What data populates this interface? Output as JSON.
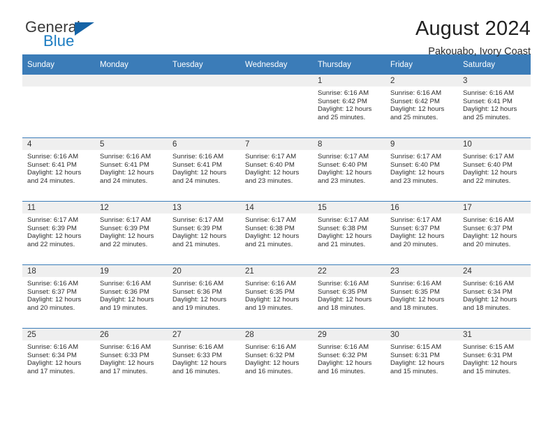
{
  "brand": {
    "name_top": "General",
    "name_bottom": "Blue",
    "triangle_color": "#1463a6",
    "blue_color": "#1b7cc2"
  },
  "header": {
    "title": "August 2024",
    "subtitle": "Pakouabo, Ivory Coast"
  },
  "theme": {
    "header_bg": "#3b7cb8",
    "daynum_bg": "#efefef",
    "grid_line": "#3b7cb8"
  },
  "labels": {
    "sunrise_prefix": "Sunrise: ",
    "sunset_prefix": "Sunset: ",
    "daylight_prefix": "Daylight: "
  },
  "weekday_headers": [
    "Sunday",
    "Monday",
    "Tuesday",
    "Wednesday",
    "Thursday",
    "Friday",
    "Saturday"
  ],
  "weeks": [
    [
      {
        "day": "",
        "empty": true
      },
      {
        "day": "",
        "empty": true
      },
      {
        "day": "",
        "empty": true
      },
      {
        "day": "",
        "empty": true
      },
      {
        "day": "1",
        "sunrise": "Sunrise: 6:16 AM",
        "sunset": "Sunset: 6:42 PM",
        "daylight": "Daylight: 12 hours and 25 minutes."
      },
      {
        "day": "2",
        "sunrise": "Sunrise: 6:16 AM",
        "sunset": "Sunset: 6:42 PM",
        "daylight": "Daylight: 12 hours and 25 minutes."
      },
      {
        "day": "3",
        "sunrise": "Sunrise: 6:16 AM",
        "sunset": "Sunset: 6:41 PM",
        "daylight": "Daylight: 12 hours and 25 minutes."
      }
    ],
    [
      {
        "day": "4",
        "sunrise": "Sunrise: 6:16 AM",
        "sunset": "Sunset: 6:41 PM",
        "daylight": "Daylight: 12 hours and 24 minutes."
      },
      {
        "day": "5",
        "sunrise": "Sunrise: 6:16 AM",
        "sunset": "Sunset: 6:41 PM",
        "daylight": "Daylight: 12 hours and 24 minutes."
      },
      {
        "day": "6",
        "sunrise": "Sunrise: 6:16 AM",
        "sunset": "Sunset: 6:41 PM",
        "daylight": "Daylight: 12 hours and 24 minutes."
      },
      {
        "day": "7",
        "sunrise": "Sunrise: 6:17 AM",
        "sunset": "Sunset: 6:40 PM",
        "daylight": "Daylight: 12 hours and 23 minutes."
      },
      {
        "day": "8",
        "sunrise": "Sunrise: 6:17 AM",
        "sunset": "Sunset: 6:40 PM",
        "daylight": "Daylight: 12 hours and 23 minutes."
      },
      {
        "day": "9",
        "sunrise": "Sunrise: 6:17 AM",
        "sunset": "Sunset: 6:40 PM",
        "daylight": "Daylight: 12 hours and 23 minutes."
      },
      {
        "day": "10",
        "sunrise": "Sunrise: 6:17 AM",
        "sunset": "Sunset: 6:40 PM",
        "daylight": "Daylight: 12 hours and 22 minutes."
      }
    ],
    [
      {
        "day": "11",
        "sunrise": "Sunrise: 6:17 AM",
        "sunset": "Sunset: 6:39 PM",
        "daylight": "Daylight: 12 hours and 22 minutes."
      },
      {
        "day": "12",
        "sunrise": "Sunrise: 6:17 AM",
        "sunset": "Sunset: 6:39 PM",
        "daylight": "Daylight: 12 hours and 22 minutes."
      },
      {
        "day": "13",
        "sunrise": "Sunrise: 6:17 AM",
        "sunset": "Sunset: 6:39 PM",
        "daylight": "Daylight: 12 hours and 21 minutes."
      },
      {
        "day": "14",
        "sunrise": "Sunrise: 6:17 AM",
        "sunset": "Sunset: 6:38 PM",
        "daylight": "Daylight: 12 hours and 21 minutes."
      },
      {
        "day": "15",
        "sunrise": "Sunrise: 6:17 AM",
        "sunset": "Sunset: 6:38 PM",
        "daylight": "Daylight: 12 hours and 21 minutes."
      },
      {
        "day": "16",
        "sunrise": "Sunrise: 6:17 AM",
        "sunset": "Sunset: 6:37 PM",
        "daylight": "Daylight: 12 hours and 20 minutes."
      },
      {
        "day": "17",
        "sunrise": "Sunrise: 6:16 AM",
        "sunset": "Sunset: 6:37 PM",
        "daylight": "Daylight: 12 hours and 20 minutes."
      }
    ],
    [
      {
        "day": "18",
        "sunrise": "Sunrise: 6:16 AM",
        "sunset": "Sunset: 6:37 PM",
        "daylight": "Daylight: 12 hours and 20 minutes."
      },
      {
        "day": "19",
        "sunrise": "Sunrise: 6:16 AM",
        "sunset": "Sunset: 6:36 PM",
        "daylight": "Daylight: 12 hours and 19 minutes."
      },
      {
        "day": "20",
        "sunrise": "Sunrise: 6:16 AM",
        "sunset": "Sunset: 6:36 PM",
        "daylight": "Daylight: 12 hours and 19 minutes."
      },
      {
        "day": "21",
        "sunrise": "Sunrise: 6:16 AM",
        "sunset": "Sunset: 6:35 PM",
        "daylight": "Daylight: 12 hours and 19 minutes."
      },
      {
        "day": "22",
        "sunrise": "Sunrise: 6:16 AM",
        "sunset": "Sunset: 6:35 PM",
        "daylight": "Daylight: 12 hours and 18 minutes."
      },
      {
        "day": "23",
        "sunrise": "Sunrise: 6:16 AM",
        "sunset": "Sunset: 6:35 PM",
        "daylight": "Daylight: 12 hours and 18 minutes."
      },
      {
        "day": "24",
        "sunrise": "Sunrise: 6:16 AM",
        "sunset": "Sunset: 6:34 PM",
        "daylight": "Daylight: 12 hours and 18 minutes."
      }
    ],
    [
      {
        "day": "25",
        "sunrise": "Sunrise: 6:16 AM",
        "sunset": "Sunset: 6:34 PM",
        "daylight": "Daylight: 12 hours and 17 minutes."
      },
      {
        "day": "26",
        "sunrise": "Sunrise: 6:16 AM",
        "sunset": "Sunset: 6:33 PM",
        "daylight": "Daylight: 12 hours and 17 minutes."
      },
      {
        "day": "27",
        "sunrise": "Sunrise: 6:16 AM",
        "sunset": "Sunset: 6:33 PM",
        "daylight": "Daylight: 12 hours and 16 minutes."
      },
      {
        "day": "28",
        "sunrise": "Sunrise: 6:16 AM",
        "sunset": "Sunset: 6:32 PM",
        "daylight": "Daylight: 12 hours and 16 minutes."
      },
      {
        "day": "29",
        "sunrise": "Sunrise: 6:16 AM",
        "sunset": "Sunset: 6:32 PM",
        "daylight": "Daylight: 12 hours and 16 minutes."
      },
      {
        "day": "30",
        "sunrise": "Sunrise: 6:15 AM",
        "sunset": "Sunset: 6:31 PM",
        "daylight": "Daylight: 12 hours and 15 minutes."
      },
      {
        "day": "31",
        "sunrise": "Sunrise: 6:15 AM",
        "sunset": "Sunset: 6:31 PM",
        "daylight": "Daylight: 12 hours and 15 minutes."
      }
    ]
  ]
}
